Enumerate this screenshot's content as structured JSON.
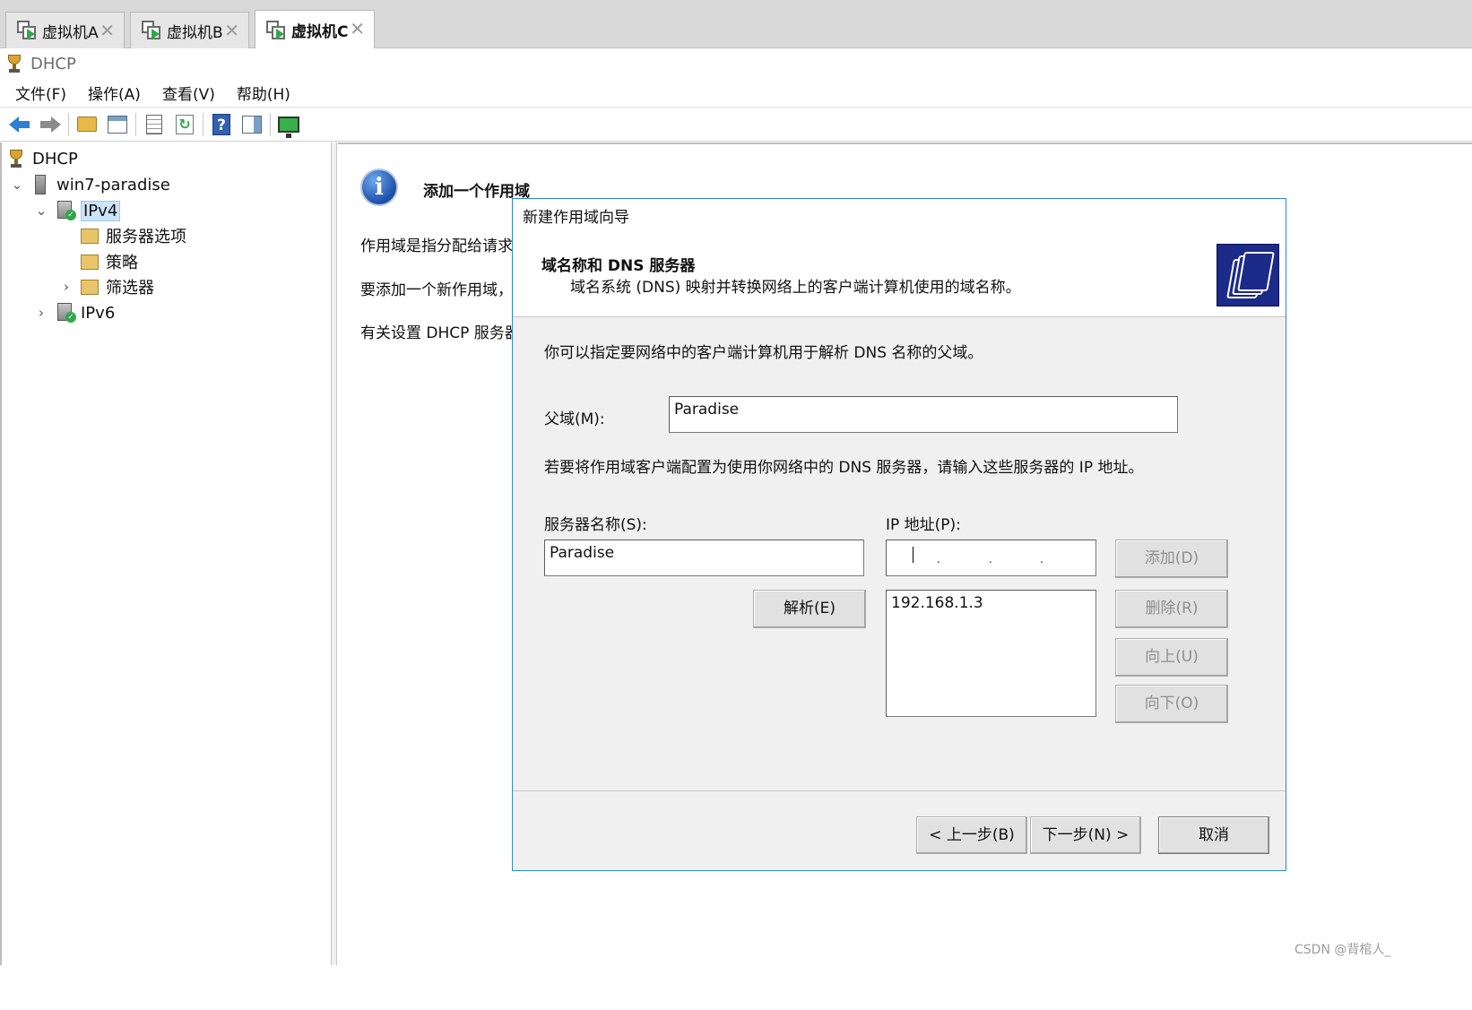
{
  "vm_tabs": [
    {
      "label": "虚拟机A",
      "close": "✕"
    },
    {
      "label": "虚拟机B",
      "close": "✕"
    },
    {
      "label": "虚拟机C",
      "close": "✕"
    }
  ],
  "window_title": "DHCP",
  "menu": [
    "文件(F)",
    "操作(A)",
    "查看(V)",
    "帮助(H)"
  ],
  "toolbar_icons": [
    "back-icon",
    "forward-icon",
    "up-folder-icon",
    "show-hide-tree-icon",
    "properties-icon",
    "refresh-icon",
    "help-icon",
    "action-pane-icon",
    "monitor-icon"
  ],
  "tree": {
    "root": "DHCP",
    "server": "win7-paradise",
    "ipv4": "IPv4",
    "server_options": "服务器选项",
    "policies": "策略",
    "filters": "筛选器",
    "ipv6": "IPv6"
  },
  "content": {
    "heading": "添加一个作用域",
    "line1": "作用域是指分配给请求",
    "line2": "要添加一个新作用域，",
    "line3": "有关设置 DHCP 服务器"
  },
  "wizard": {
    "title": "新建作用域向导",
    "header_title": "域名称和 DNS 服务器",
    "header_subtitle": "域名系统 (DNS) 映射并转换网络上的客户端计算机使用的域名称。",
    "intro": "你可以指定要网络中的客户端计算机用于解析 DNS 名称的父域。",
    "parent_domain_label": "父域(M):",
    "parent_domain_value": "Paradise",
    "dns_instruction": "若要将作用域客户端配置为使用你网络中的 DNS 服务器，请输入这些服务器的 IP 地址。",
    "server_name_label": "服务器名称(S):",
    "server_name_value": "Paradise",
    "ip_label": "IP 地址(P):",
    "ip_dots": [
      ".",
      ".",
      "."
    ],
    "resolve_button": "解析(E)",
    "add_button": "添加(D)",
    "remove_button": "删除(R)",
    "up_button": "向上(U)",
    "down_button": "向下(O)",
    "ip_list": [
      "192.168.1.3"
    ],
    "back_button": "< 上一步(B)",
    "next_button": "下一步(N) >",
    "cancel_button": "取消"
  },
  "watermark": "CSDN @背棺人_",
  "colors": {
    "dialog_border": "#2b88d8",
    "wizard_header_image": "#1c2a8a",
    "selection": "#cce4f7"
  }
}
